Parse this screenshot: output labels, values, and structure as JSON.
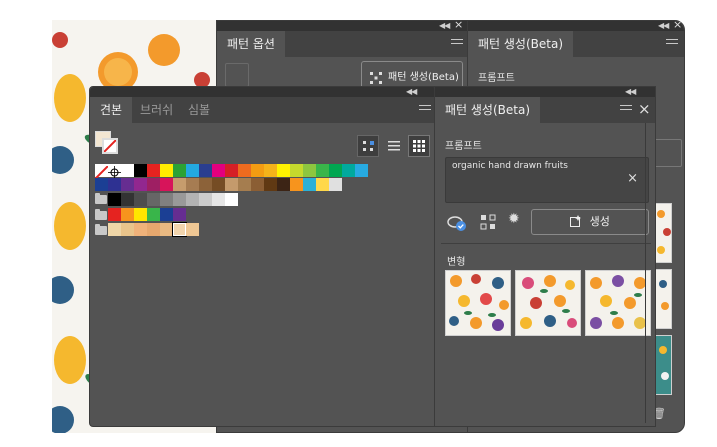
{
  "swatches_panel": {
    "tabs": [
      "견본",
      "브러쉬",
      "심볼"
    ],
    "active_tab": 0
  },
  "pattern_options_panel": {
    "tab": "패턴 옵션",
    "button": "패턴 생성(Beta)"
  },
  "pattern_generation_panel": {
    "tab": "패턴 생성(Beta)",
    "prompt_label": "프롬프트",
    "prompt_value": "organic hand drawn fruits",
    "generate_label": "생성",
    "variations_label": "변형"
  },
  "back_pattern_generation_panel": {
    "tab": "패턴 생성(Beta)",
    "prompt_label": "프롬프트"
  },
  "colors": {
    "panel_bg": "#535353",
    "tab_bar": "#424242",
    "accent_blue": "#4a8fe2"
  },
  "swatch_rows": {
    "row1": [
      "#ffffff",
      "#000000",
      "#e52320",
      "#ffeb00",
      "#2ba235",
      "#23a9e1",
      "#2a3e8f",
      "#e3007e",
      "#d51f26",
      "#ed6b1f",
      "#f39c12",
      "#f5b31a",
      "#fff200",
      "#c5d92d",
      "#8dc63f",
      "#39b54a",
      "#00a651",
      "#00a99d",
      "#27aae1"
    ],
    "row2": [
      "#1b3f94",
      "#2e3192",
      "#662d91",
      "#92278f",
      "#9e1f63",
      "#d7145a",
      "#c69c6d",
      "#a67c52",
      "#8c6239",
      "#754c24",
      "#c49a6c",
      "#a57d4f",
      "#8b5e34",
      "#603913",
      "#3c2415",
      "#f7941d",
      "#2bb0d6",
      "#ffd84a",
      "#e0e0e0"
    ],
    "row3": [
      "#000000",
      "#333333",
      "#4d4d4d",
      "#666666",
      "#808080",
      "#999999",
      "#b3b3b3",
      "#cccccc",
      "#e6e6e6",
      "#ffffff"
    ],
    "row4": [
      "#e52320",
      "#f7941d",
      "#ffe600",
      "#39b54a",
      "#1b3f94",
      "#662d91"
    ]
  }
}
